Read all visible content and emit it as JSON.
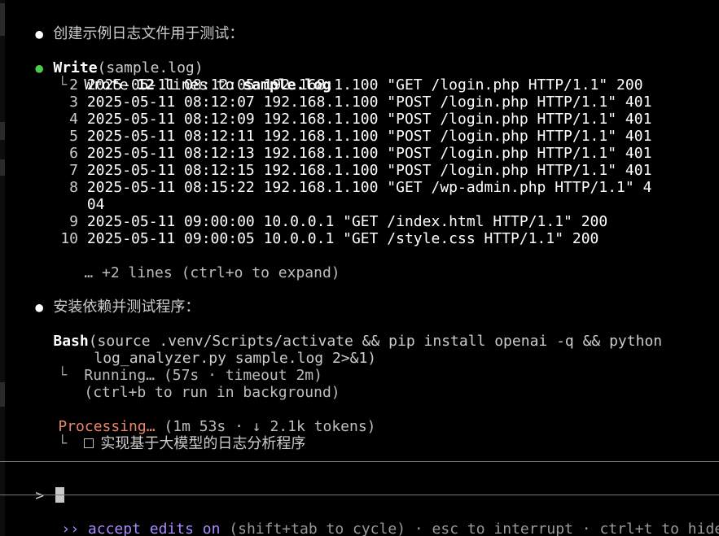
{
  "messages": {
    "create_sample": "创建示例日志文件用于测试：",
    "install_and_test": "安装依赖并测试程序："
  },
  "write": {
    "tool": "Write",
    "args": "(sample.log)",
    "result_prefix": "Wrote ",
    "line_count": "12",
    "result_mid": " lines to ",
    "file": "sample.log",
    "lines": [
      {
        "n": "2",
        "text": "2025-05-11 08:12:05 192.168.1.100 \"GET /login.php HTTP/1.1\" 200"
      },
      {
        "n": "3",
        "text": "2025-05-11 08:12:07 192.168.1.100 \"POST /login.php HTTP/1.1\" 401"
      },
      {
        "n": "4",
        "text": "2025-05-11 08:12:09 192.168.1.100 \"POST /login.php HTTP/1.1\" 401"
      },
      {
        "n": "5",
        "text": "2025-05-11 08:12:11 192.168.1.100 \"POST /login.php HTTP/1.1\" 401"
      },
      {
        "n": "6",
        "text": "2025-05-11 08:12:13 192.168.1.100 \"POST /login.php HTTP/1.1\" 401"
      },
      {
        "n": "7",
        "text": "2025-05-11 08:12:15 192.168.1.100 \"POST /login.php HTTP/1.1\" 401"
      },
      {
        "n": "8",
        "text": "2025-05-11 08:15:22 192.168.1.100 \"GET /wp-admin.php HTTP/1.1\" 4"
      },
      {
        "n": "",
        "text": "04"
      },
      {
        "n": "9",
        "text": "2025-05-11 09:00:00 10.0.0.1 \"GET /index.html HTTP/1.1\" 200"
      },
      {
        "n": "10",
        "text": "2025-05-11 09:00:05 10.0.0.1 \"GET /style.css HTTP/1.1\" 200"
      }
    ],
    "more": "… +2 lines (ctrl+o to expand)"
  },
  "bash": {
    "tool": "Bash",
    "args_line1": "(source .venv/Scripts/activate && pip install openai -q && python",
    "args_line2": "log_analyzer.py sample.log 2>&1)",
    "status_line1": "Running… (57s · timeout 2m)",
    "status_line2": "(ctrl+b to run in background)"
  },
  "processing": {
    "label": "Processing…",
    "detail": " (1m 53s · ↓ 2.1k tokens)",
    "todo": "实现基于大模型的日志分析程序"
  },
  "prompt": {
    "symbol": ">"
  },
  "footer": {
    "arrows": "››",
    "mode": "accept edits on",
    "hint": " (shift+tab to cycle) · esc to interrupt · ctrl+t to hide…"
  },
  "colors": {
    "background": "#000000",
    "text": "#cccccc",
    "green_bullet": "#4ec94e",
    "processing": "#e8866a",
    "accent": "#a78bfa"
  }
}
